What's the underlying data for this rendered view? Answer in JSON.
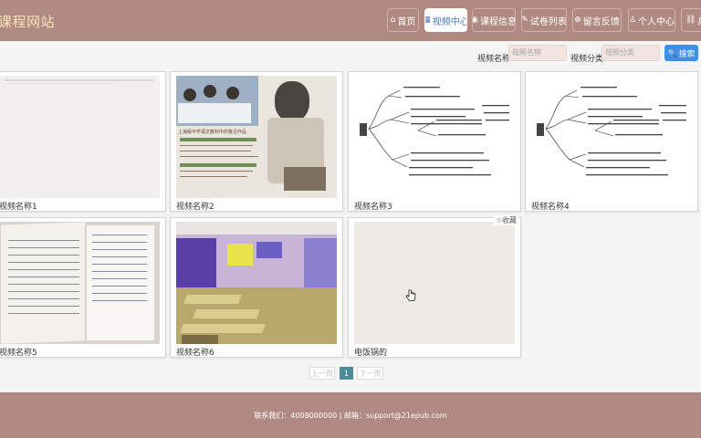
{
  "site": {
    "title": "课程网站"
  },
  "nav": [
    {
      "icon": "⌂",
      "label": "首页"
    },
    {
      "icon": "▦",
      "label": "视频中心"
    },
    {
      "icon": "◉",
      "label": "课程信息"
    },
    {
      "icon": "✎",
      "label": "试卷列表"
    },
    {
      "icon": "⊕",
      "label": "留言反馈"
    },
    {
      "icon": "♙",
      "label": "个人中心"
    },
    {
      "icon": "⛓",
      "label": "后"
    }
  ],
  "search": {
    "name_label": "视频名称",
    "name_placeholder": "视频名称",
    "category_label": "视频分类",
    "category_placeholder": "视频分类",
    "button_label": "搜索",
    "button_icon": "🔍"
  },
  "videos": [
    {
      "caption": "视频名称1"
    },
    {
      "caption": "视频名称2",
      "banner": "上海版中学语文教材中的鲁迅作品"
    },
    {
      "caption": "视频名称3"
    },
    {
      "caption": "视频名称4"
    },
    {
      "caption": "视频名称5"
    },
    {
      "caption": "视频名称6"
    },
    {
      "caption": "电饭锅的",
      "fav_label": "收藏"
    }
  ],
  "pagination": {
    "prev": "上一页",
    "current": "1",
    "next": "下一页"
  },
  "footer": {
    "text": "联系我们：4008000000 | 邮箱：support@21epub.com"
  },
  "colors": {
    "header": "#b08a82",
    "logo": "#fbe4b7",
    "active_nav_text": "#4a77b8",
    "search_button": "#3d8fe8",
    "page_current": "#4b8c98"
  }
}
